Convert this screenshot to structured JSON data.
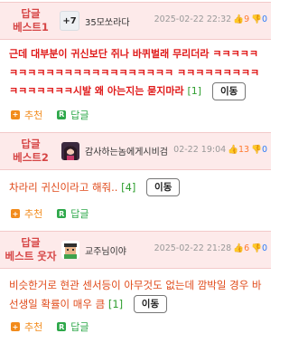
{
  "comments": [
    {
      "rank_line1": "답글",
      "rank_line2": "베스트1",
      "badge": "+7",
      "nickname": "35모쏘라다",
      "date": "2025-02-22 22:32",
      "up_count": "9",
      "down_count": "0",
      "body": "근데 대부분이 귀신보단 쥐나 바퀴벌래 무리더라 ㅋㅋㅋㅋㅋㅋㅋㅋㅋㅋㅋㅋㅋㅋㅋㅋㅋㅋㅋㅋㅋㅋㅋ ㅋㅋㅋㅋㅋㅋㅋㅋㅋㅋㅋㅋㅋㅋㅋㅋ시발 왜 아는지는 묻지마라",
      "reply_count": "[1]",
      "move_label": "이동",
      "recommend_label": "추천",
      "reply_label": "답글"
    },
    {
      "rank_line1": "답글",
      "rank_line2": "베스트2",
      "nickname": "감사하는놈에게시비검",
      "date": "02-22 19:04",
      "up_count": "13",
      "down_count": "0",
      "body": "차라리 귀신이라고 해줘..",
      "reply_count": "[4]",
      "move_label": "이동",
      "recommend_label": "추천",
      "reply_label": "답글"
    },
    {
      "rank_line1": "답글",
      "rank_line2": "베스트",
      "rank_suffix": "웃자",
      "nickname": "교주님이야",
      "date": "2025-02-22 21:28",
      "up_count": "6",
      "down_count": "0",
      "body": "비슷한거로 현관 센서등이 아무것도 없는데 깜박일 경우 바선생일 확률이 매우 큼",
      "reply_count": "[1]",
      "move_label": "이동",
      "recommend_label": "추천",
      "reply_label": "답글"
    }
  ],
  "icons": {
    "thumbs_up": "thumbs-up-icon",
    "thumbs_down": "thumbs-down-icon",
    "recommend": "plus-square-icon",
    "reply": "reply-square-icon"
  },
  "colors": {
    "header_bg": "#fdeaea",
    "rank_text": "#d64545",
    "body_text": "#e04a1a",
    "recommend": "#f28b1c",
    "reply": "#2ea84a"
  }
}
